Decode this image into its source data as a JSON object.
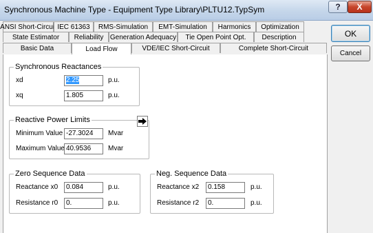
{
  "window": {
    "title": "Synchronous Machine Type - Equipment Type Library\\PLTU12.TypSym",
    "help_label": "?",
    "close_label": "X"
  },
  "tabs": {
    "row1": [
      "ANSI Short-Circuit",
      "IEC 61363",
      "RMS-Simulation",
      "EMT-Simulation",
      "Harmonics",
      "Optimization"
    ],
    "row2": [
      "State Estimator",
      "Reliability",
      "Generation Adequacy",
      "Tie Open Point Opt.",
      "Description"
    ],
    "row3": [
      "Basic Data",
      "Load Flow",
      "VDE/IEC Short-Circuit",
      "Complete Short-Circuit"
    ],
    "selected": "Load Flow"
  },
  "buttons": {
    "ok": "OK",
    "cancel": "Cancel"
  },
  "sync_reactances": {
    "title": "Synchronous Reactances",
    "xd_label": "xd",
    "xd_value": "2.25",
    "xd_unit": "p.u.",
    "xq_label": "xq",
    "xq_value": "1.805",
    "xq_unit": "p.u."
  },
  "reactive_limits": {
    "title": "Reactive Power Limits",
    "min_label": "Minimum Value",
    "min_value": "-27.3024",
    "min_unit": "Mvar",
    "max_label": "Maximum Value",
    "max_value": "40.9536",
    "max_unit": "Mvar"
  },
  "zero_seq": {
    "title": "Zero Sequence Data",
    "x0_label": "Reactance x0",
    "x0_value": "0.084",
    "x0_unit": "p.u.",
    "r0_label": "Resistance r0",
    "r0_value": "0.",
    "r0_unit": "p.u."
  },
  "neg_seq": {
    "title": "Neg. Sequence Data",
    "x2_label": "Reactance x2",
    "x2_value": "0.158",
    "x2_unit": "p.u.",
    "r2_label": "Resistance r2",
    "r2_value": "0.",
    "r2_unit": "p.u."
  },
  "colors": {
    "selection": "#3399ff",
    "close": "#c7452b"
  },
  "icons": {
    "limits_action": "right-arrow-icon"
  }
}
